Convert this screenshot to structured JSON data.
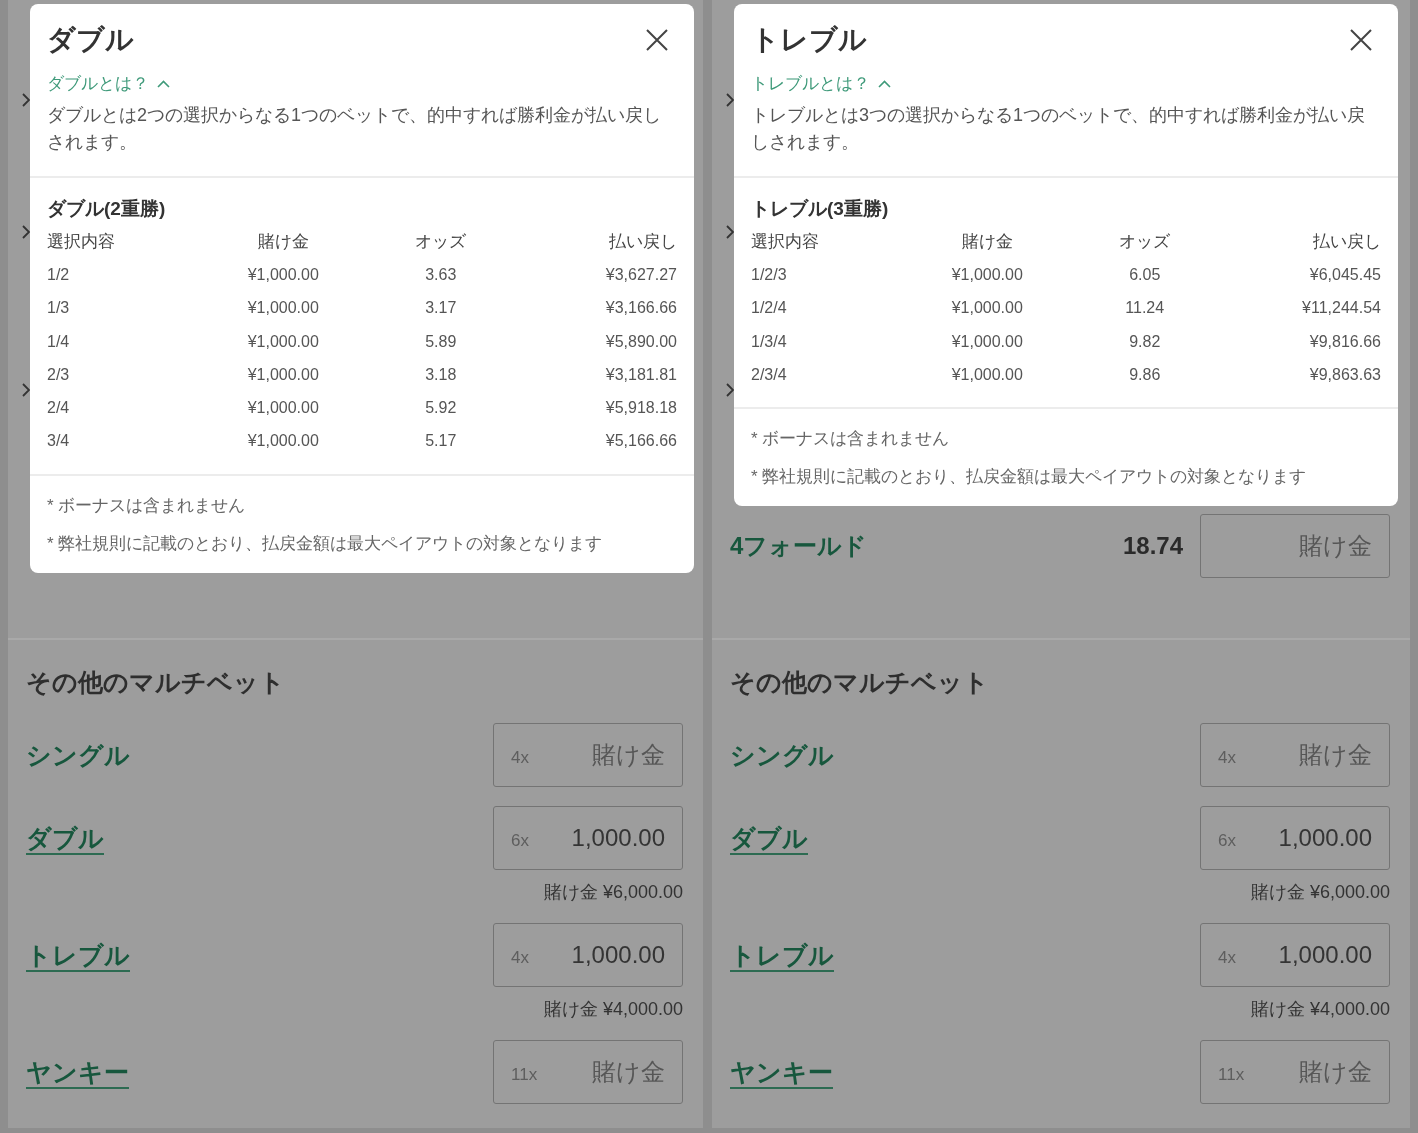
{
  "panels": [
    {
      "popup": {
        "title": "ダブル",
        "info_link": {
          "label": "ダブルとは？",
          "expanded": true
        },
        "description": "ダブルとは2つの選択からなる1つのベットで、的中すれば勝利金が払い戻しされます。",
        "table": {
          "title": "ダブル(2重勝)",
          "columns": [
            "選択内容",
            "賭け金",
            "オッズ",
            "払い戻し"
          ],
          "rows": [
            [
              "1/2",
              "¥1,000.00",
              "3.63",
              "¥3,627.27"
            ],
            [
              "1/3",
              "¥1,000.00",
              "3.17",
              "¥3,166.66"
            ],
            [
              "1/4",
              "¥1,000.00",
              "5.89",
              "¥5,890.00"
            ],
            [
              "2/3",
              "¥1,000.00",
              "3.18",
              "¥3,181.81"
            ],
            [
              "2/4",
              "¥1,000.00",
              "5.92",
              "¥5,918.18"
            ],
            [
              "3/4",
              "¥1,000.00",
              "5.17",
              "¥5,166.66"
            ]
          ]
        },
        "notes": [
          "* ボーナスは含まれません",
          "* 弊社規則に記載のとおり、払戻金額は最大ペイアウトの対象となります"
        ]
      },
      "other_multiples": {
        "title": "その他のマルチベット",
        "bets": [
          {
            "name": "シングル",
            "link": false,
            "multiplier": "4x",
            "placeholder": "賭け金"
          },
          {
            "name": "ダブル",
            "link": true,
            "multiplier": "6x",
            "value": "1,000.00",
            "total": "賭け金 ¥6,000.00"
          },
          {
            "name": "トレブル",
            "link": true,
            "multiplier": "4x",
            "value": "1,000.00",
            "total": "賭け金 ¥4,000.00"
          },
          {
            "name": "ヤンキー",
            "link": true,
            "multiplier": "11x",
            "placeholder": "賭け金"
          }
        ]
      }
    },
    {
      "popup": {
        "title": "トレブル",
        "info_link": {
          "label": "トレブルとは？",
          "expanded": true
        },
        "description": "トレブルとは3つの選択からなる1つのベットで、的中すれば勝利金が払い戻しされます。",
        "table": {
          "title": "トレブル(3重勝)",
          "columns": [
            "選択内容",
            "賭け金",
            "オッズ",
            "払い戻し"
          ],
          "rows": [
            [
              "1/2/3",
              "¥1,000.00",
              "6.05",
              "¥6,045.45"
            ],
            [
              "1/2/4",
              "¥1,000.00",
              "11.24",
              "¥11,244.54"
            ],
            [
              "1/3/4",
              "¥1,000.00",
              "9.82",
              "¥9,816.66"
            ],
            [
              "2/3/4",
              "¥1,000.00",
              "9.86",
              "¥9,863.63"
            ]
          ]
        },
        "notes": [
          "* ボーナスは含まれません",
          "* 弊社規則に記載のとおり、払戻金額は最大ペイアウトの対象となります"
        ]
      },
      "fold_bet": {
        "name": "4フォールド",
        "odds": "18.74",
        "placeholder": "賭け金"
      },
      "other_multiples": {
        "title": "その他のマルチベット",
        "bets": [
          {
            "name": "シングル",
            "link": false,
            "multiplier": "4x",
            "placeholder": "賭け金"
          },
          {
            "name": "ダブル",
            "link": true,
            "multiplier": "6x",
            "value": "1,000.00",
            "total": "賭け金 ¥6,000.00"
          },
          {
            "name": "トレブル",
            "link": true,
            "multiplier": "4x",
            "value": "1,000.00",
            "total": "賭け金 ¥4,000.00"
          },
          {
            "name": "ヤンキー",
            "link": true,
            "multiplier": "11x",
            "placeholder": "賭け金"
          }
        ]
      }
    }
  ]
}
